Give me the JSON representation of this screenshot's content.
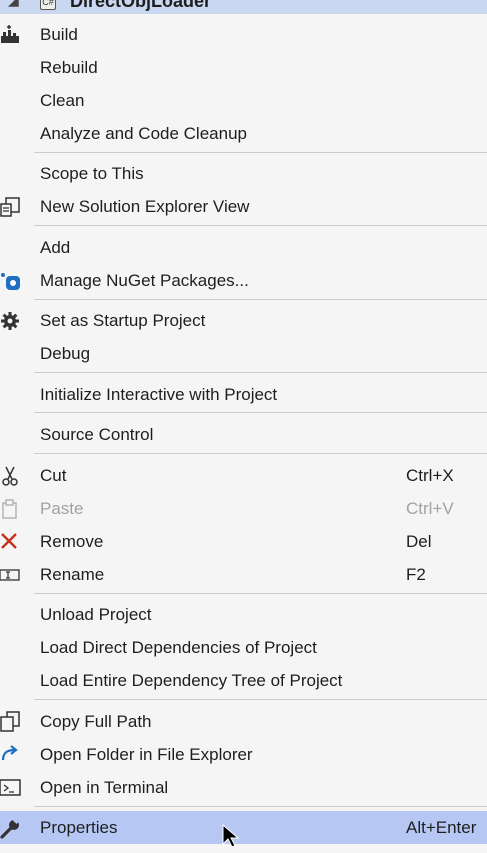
{
  "underlay": {
    "title": "DirectObjLoader"
  },
  "menu": {
    "items": [
      {
        "label": "Build",
        "icon": "build-icon"
      },
      {
        "label": "Rebuild"
      },
      {
        "label": "Clean"
      },
      {
        "label": "Analyze and Code Cleanup"
      },
      {
        "label": "Scope to This"
      },
      {
        "label": "New Solution Explorer View",
        "icon": "new-view-icon"
      },
      {
        "label": "Add"
      },
      {
        "label": "Manage NuGet Packages...",
        "icon": "nuget-icon"
      },
      {
        "label": "Set as Startup Project",
        "icon": "gear-icon"
      },
      {
        "label": "Debug"
      },
      {
        "label": "Initialize Interactive with Project"
      },
      {
        "label": "Source Control"
      },
      {
        "label": "Cut",
        "shortcut": "Ctrl+X",
        "icon": "scissors-icon"
      },
      {
        "label": "Paste",
        "shortcut": "Ctrl+V",
        "icon": "paste-icon",
        "disabled": true
      },
      {
        "label": "Remove",
        "shortcut": "Del",
        "icon": "remove-x-icon"
      },
      {
        "label": "Rename",
        "shortcut": "F2",
        "icon": "rename-icon"
      },
      {
        "label": "Unload Project"
      },
      {
        "label": "Load Direct Dependencies of Project"
      },
      {
        "label": "Load Entire Dependency Tree of Project"
      },
      {
        "label": "Copy Full Path",
        "icon": "copy-icon"
      },
      {
        "label": "Open Folder in File Explorer",
        "icon": "open-folder-arrow-icon"
      },
      {
        "label": "Open in Terminal",
        "icon": "terminal-icon"
      },
      {
        "label": "Properties",
        "shortcut": "Alt+Enter",
        "icon": "wrench-icon",
        "highlighted": true
      }
    ]
  },
  "colors": {
    "background": "#f5f5f5",
    "highlight": "#b6c7f4",
    "separator": "#cccccc",
    "text": "#1e1e1e",
    "disabled_text": "#a2a2a2",
    "remove_icon": "#c4311c",
    "accent_blue": "#1e6fc1"
  }
}
